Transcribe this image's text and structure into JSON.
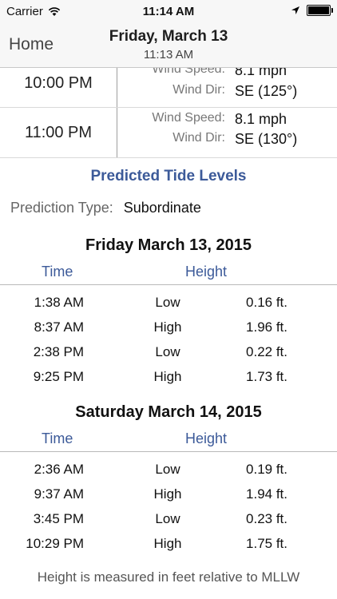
{
  "status_bar": {
    "carrier": "Carrier",
    "time": "11:14 AM"
  },
  "nav": {
    "back_label": "Home",
    "title": "Friday, March 13",
    "subtitle": "11:13 AM"
  },
  "weather_rows": [
    {
      "time": "10:00 PM",
      "wind_speed_label": "Wind Speed:",
      "wind_speed": "8.1 mph",
      "wind_dir_label": "Wind Dir:",
      "wind_dir": "SE (125°)"
    },
    {
      "time": "11:00 PM",
      "wind_speed_label": "Wind Speed:",
      "wind_speed": "8.1 mph",
      "wind_dir_label": "Wind Dir:",
      "wind_dir": "SE (130°)"
    }
  ],
  "tides": {
    "section_title": "Predicted Tide Levels",
    "prediction_type_label": "Prediction Type:",
    "prediction_type": "Subordinate",
    "col_time": "Time",
    "col_height": "Height",
    "days": [
      {
        "heading": "Friday March 13, 2015",
        "rows": [
          {
            "time": "1:38 AM",
            "kind": "Low",
            "height": "0.16 ft."
          },
          {
            "time": "8:37 AM",
            "kind": "High",
            "height": "1.96 ft."
          },
          {
            "time": "2:38 PM",
            "kind": "Low",
            "height": "0.22 ft."
          },
          {
            "time": "9:25 PM",
            "kind": "High",
            "height": "1.73 ft."
          }
        ]
      },
      {
        "heading": "Saturday March 14, 2015",
        "rows": [
          {
            "time": "2:36 AM",
            "kind": "Low",
            "height": "0.19 ft."
          },
          {
            "time": "9:37 AM",
            "kind": "High",
            "height": "1.94 ft."
          },
          {
            "time": "3:45 PM",
            "kind": "Low",
            "height": "0.23 ft."
          },
          {
            "time": "10:29 PM",
            "kind": "High",
            "height": "1.75 ft."
          }
        ]
      }
    ],
    "footer": "Height is measured in feet relative to MLLW"
  }
}
